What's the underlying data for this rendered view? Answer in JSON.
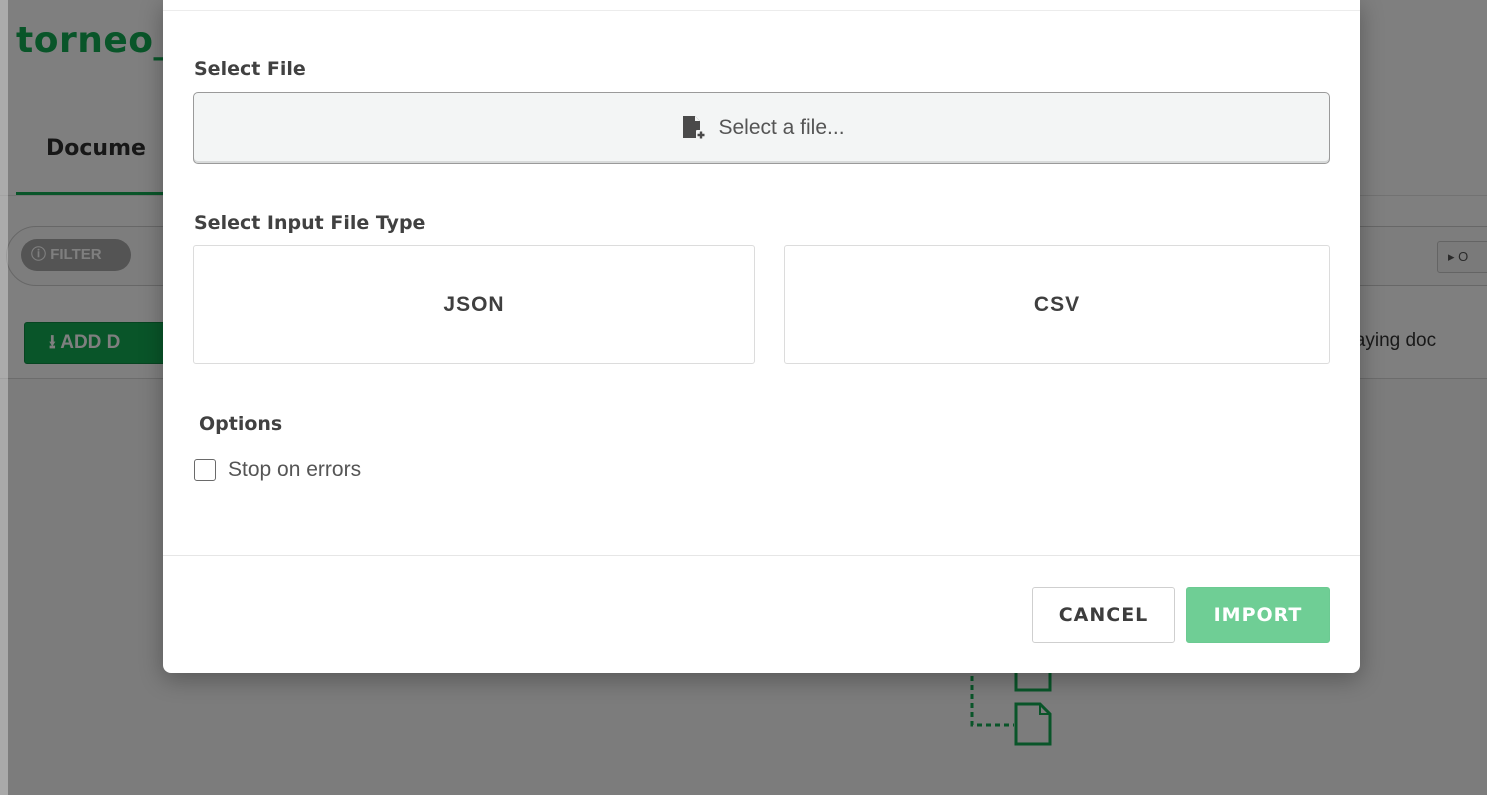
{
  "background": {
    "app_title": "torneo_",
    "tab_documents": "Docume",
    "filter_label": "FILTER",
    "options_label": "▸ O",
    "add_button_label": "ADD D",
    "displaying_text": "playing doc"
  },
  "modal": {
    "select_file_label": "Select File",
    "file_button_text": "Select a file...",
    "input_type_label": "Select Input File Type",
    "file_types": [
      "JSON",
      "CSV"
    ],
    "options_label": "Options",
    "stop_on_errors_label": "Stop on errors",
    "stop_on_errors_checked": false,
    "cancel_label": "CANCEL",
    "import_label": "IMPORT"
  },
  "icons": {
    "file_icon": "add-file-icon",
    "filter_icon": "info-circle-icon",
    "add_icon": "download-icon"
  },
  "colors": {
    "brand_green": "#13aa52",
    "import_button": "#6fce95"
  }
}
